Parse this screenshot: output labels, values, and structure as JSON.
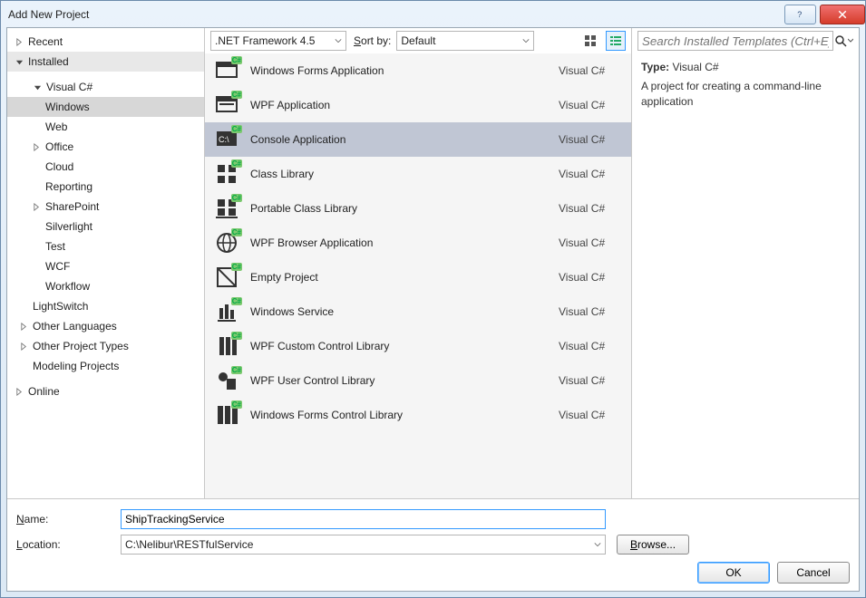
{
  "window": {
    "title": "Add New Project"
  },
  "tree": {
    "recent": "Recent",
    "installed": "Installed",
    "visual_csharp": "Visual C#",
    "windows": "Windows",
    "web": "Web",
    "office": "Office",
    "cloud": "Cloud",
    "reporting": "Reporting",
    "sharepoint": "SharePoint",
    "silverlight": "Silverlight",
    "test": "Test",
    "wcf": "WCF",
    "workflow": "Workflow",
    "lightswitch": "LightSwitch",
    "other_languages": "Other Languages",
    "other_project_types": "Other Project Types",
    "modeling_projects": "Modeling Projects",
    "online": "Online"
  },
  "toolbar": {
    "framework": ".NET Framework 4.5",
    "sort_label": "Sort by:",
    "sort_value": "Default"
  },
  "templates": [
    {
      "name": "Windows Forms Application",
      "lang": "Visual C#"
    },
    {
      "name": "WPF Application",
      "lang": "Visual C#"
    },
    {
      "name": "Console Application",
      "lang": "Visual C#",
      "selected": true
    },
    {
      "name": "Class Library",
      "lang": "Visual C#"
    },
    {
      "name": "Portable Class Library",
      "lang": "Visual C#"
    },
    {
      "name": "WPF Browser Application",
      "lang": "Visual C#"
    },
    {
      "name": "Empty Project",
      "lang": "Visual C#"
    },
    {
      "name": "Windows Service",
      "lang": "Visual C#"
    },
    {
      "name": "WPF Custom Control Library",
      "lang": "Visual C#"
    },
    {
      "name": "WPF User Control Library",
      "lang": "Visual C#"
    },
    {
      "name": "Windows Forms Control Library",
      "lang": "Visual C#"
    }
  ],
  "search": {
    "placeholder": "Search Installed Templates (Ctrl+E)"
  },
  "detail": {
    "type_label": "Type:",
    "type_value": "Visual C#",
    "description": "A project for creating a command-line application"
  },
  "fields": {
    "name_label": "Name:",
    "name_value": "ShipTrackingService",
    "location_label": "Location:",
    "location_value": "C:\\Nelibur\\RESTfulService",
    "browse": "Browse..."
  },
  "buttons": {
    "ok": "OK",
    "cancel": "Cancel"
  },
  "badge": "C#"
}
